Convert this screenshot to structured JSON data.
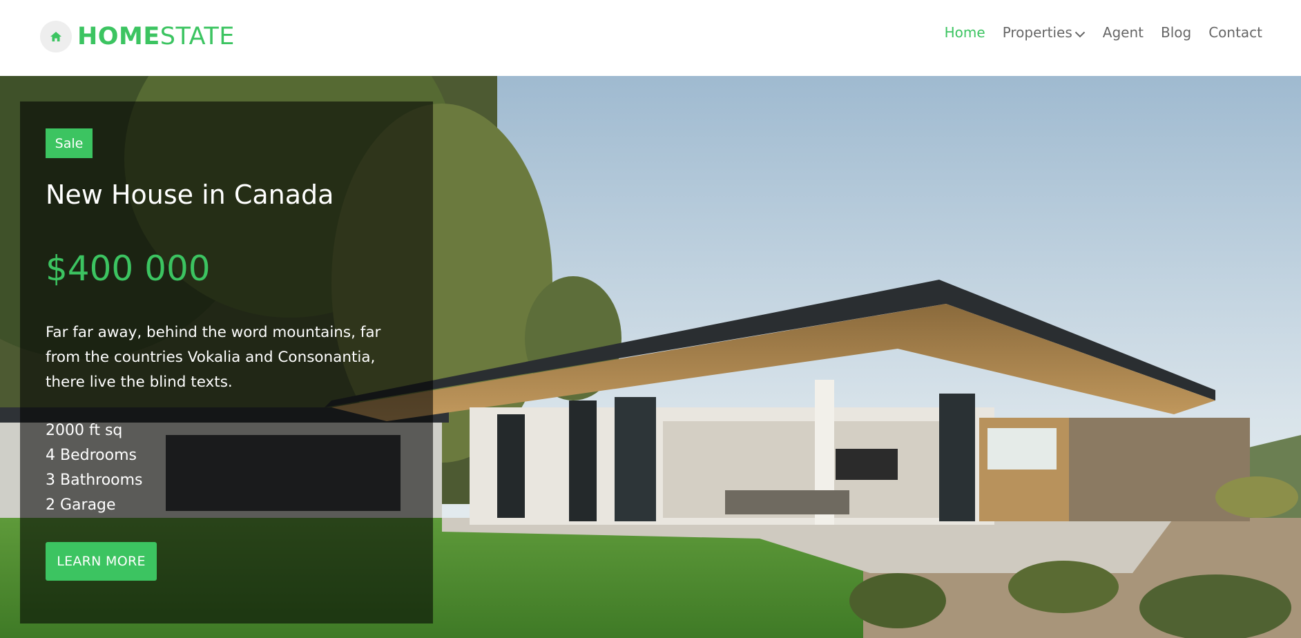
{
  "brand": {
    "name_bold": "HOME",
    "name_light": "STATE",
    "icon": "home-icon"
  },
  "nav": {
    "items": [
      {
        "label": "Home",
        "active": true
      },
      {
        "label": "Properties",
        "has_dropdown": true,
        "icon": "chevron-down-icon"
      },
      {
        "label": "Agent"
      },
      {
        "label": "Blog"
      },
      {
        "label": "Contact"
      }
    ]
  },
  "hero": {
    "badge": "Sale",
    "title": "New House in Canada",
    "price": "$400 000",
    "description": "Far far away, behind the word mountains, far from the countries Vokalia and Consonantia, there live the blind texts.",
    "specs": [
      "2000 ft sq",
      "4 Bedrooms",
      "3 Bathrooms",
      "2 Garage"
    ],
    "cta_label": "LEARN MORE"
  },
  "colors": {
    "accent": "#3cc461",
    "nav_text": "#666666",
    "overlay": "rgba(0,0,0,0.56)"
  }
}
